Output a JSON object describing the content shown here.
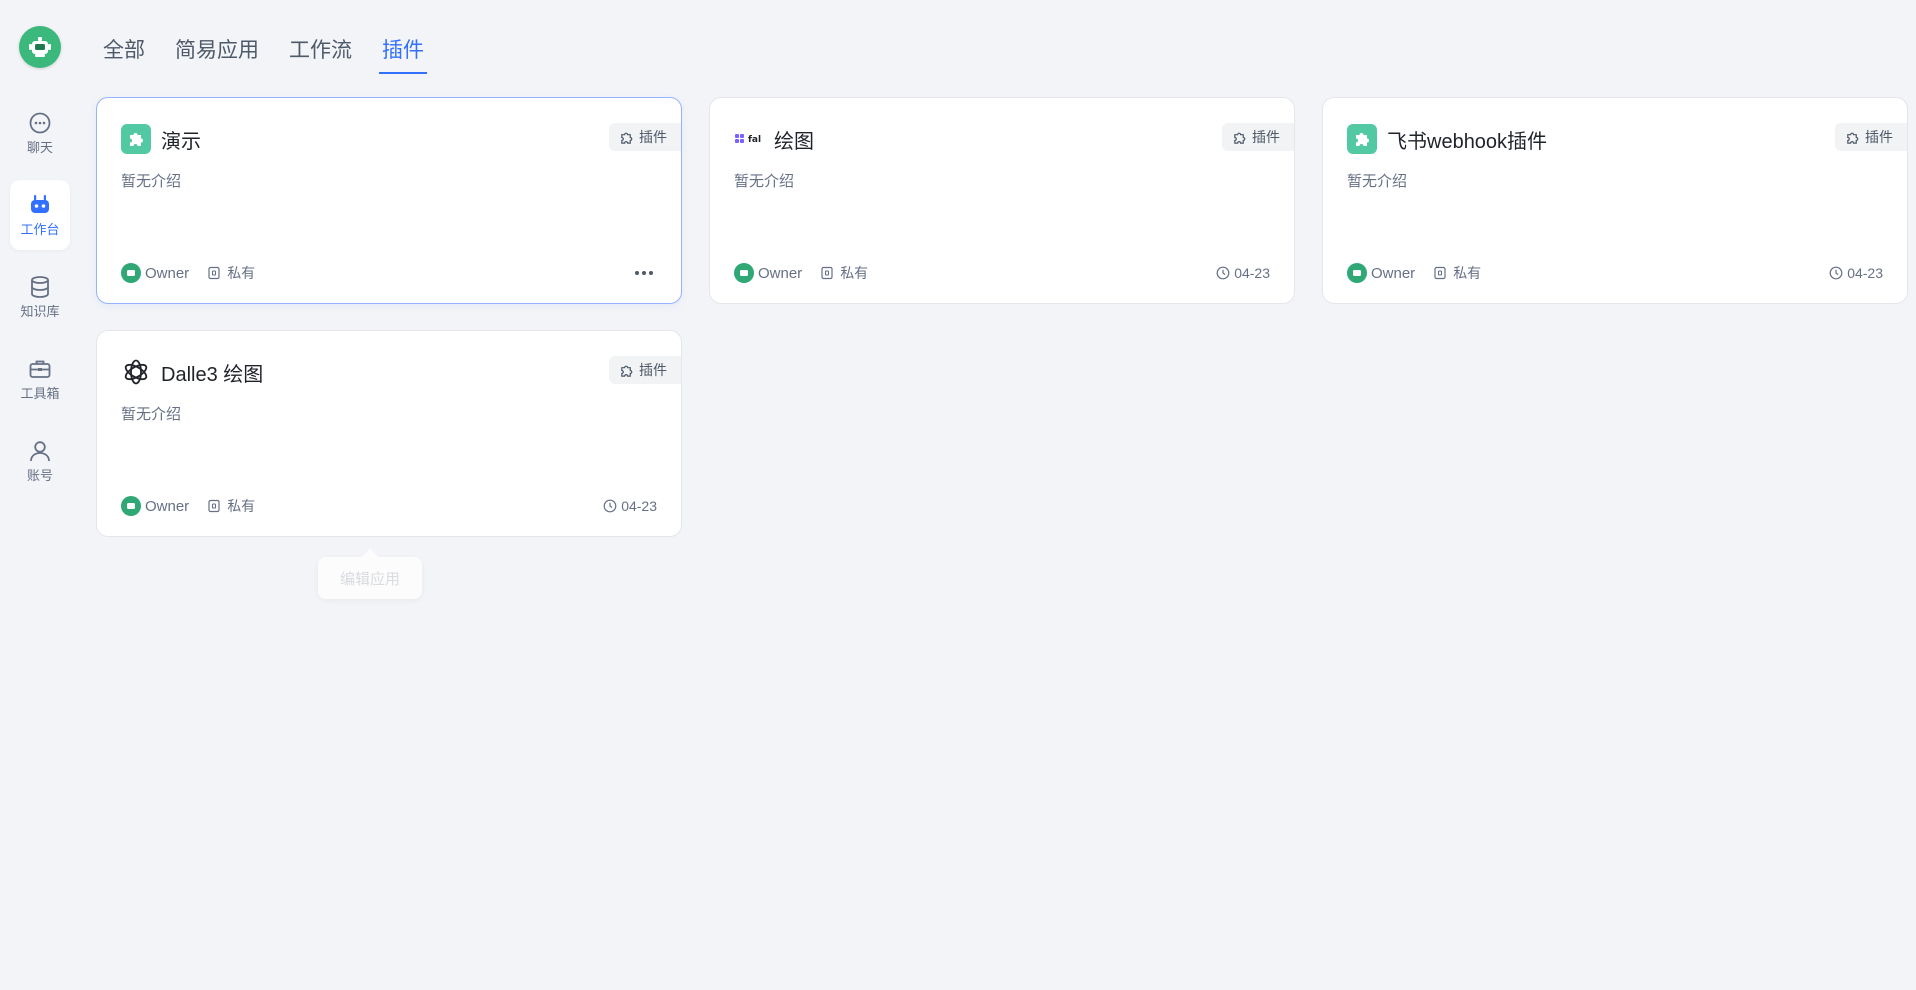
{
  "sidebar": {
    "items": [
      {
        "label": "聊天",
        "icon": "chat-icon"
      },
      {
        "label": "工作台",
        "icon": "robot-icon",
        "active": true
      },
      {
        "label": "知识库",
        "icon": "database-icon"
      },
      {
        "label": "工具箱",
        "icon": "toolbox-icon"
      },
      {
        "label": "账号",
        "icon": "user-icon"
      }
    ]
  },
  "tabs": [
    {
      "label": "全部"
    },
    {
      "label": "简易应用"
    },
    {
      "label": "工作流"
    },
    {
      "label": "插件",
      "active": true
    }
  ],
  "cards": [
    {
      "title": "演示",
      "badge": "插件",
      "desc": "暂无介绍",
      "owner": "Owner",
      "visibility": "私有",
      "date": "",
      "icon": "puzzle-icon"
    },
    {
      "title": "绘图",
      "badge": "插件",
      "desc": "暂无介绍",
      "owner": "Owner",
      "visibility": "私有",
      "date": "04-23",
      "icon": "fal-logo-icon",
      "icon_text": "fal"
    },
    {
      "title": "飞书webhook插件",
      "badge": "插件",
      "desc": "暂无介绍",
      "owner": "Owner",
      "visibility": "私有",
      "date": "04-23",
      "icon": "puzzle-icon"
    },
    {
      "title": "Dalle3 绘图",
      "badge": "插件",
      "desc": "暂无介绍",
      "owner": "Owner",
      "visibility": "私有",
      "date": "04-23",
      "icon": "openai-icon"
    }
  ],
  "tooltip": {
    "label": "编辑应用"
  },
  "colors": {
    "accent": "#3370ff",
    "plugin_icon": "#52c9a2",
    "background": "#f3f4f7"
  }
}
